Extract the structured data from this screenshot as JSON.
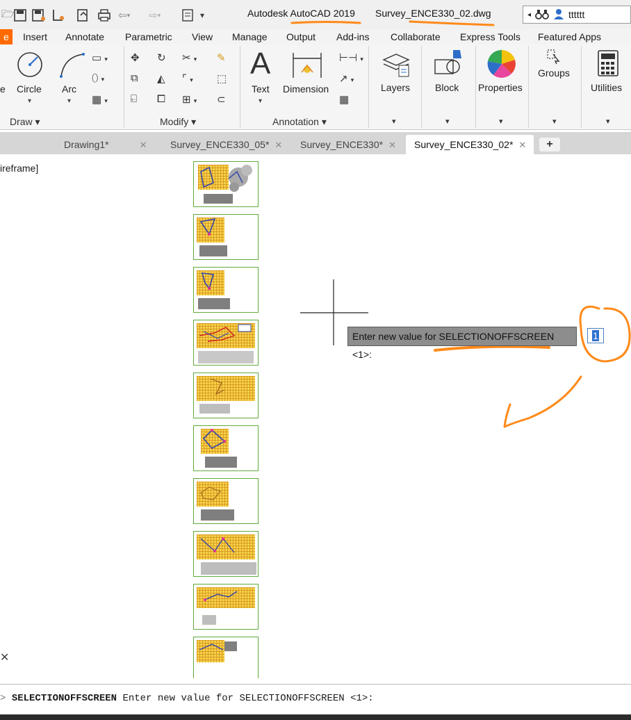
{
  "titlebar": {
    "app_title": "Autodesk AutoCAD 2019",
    "doc_title": "Survey_ENCE330_02.dwg",
    "user": "tttttt",
    "quick_access_icons": [
      "open-icon",
      "save-icon",
      "save-as-icon",
      "plot-preview-icon",
      "publish-icon",
      "print-icon",
      "undo-icon",
      "redo-icon",
      "workspace-icon",
      "customize-icon"
    ],
    "search_icons": [
      "back-arrow-icon",
      "binoculars-icon",
      "user-icon"
    ]
  },
  "ribbon_tabs": [
    "e",
    "Insert",
    "Annotate",
    "Parametric",
    "View",
    "Manage",
    "Output",
    "Add-ins",
    "Collaborate",
    "Express Tools",
    "Featured Apps"
  ],
  "ribbon": {
    "draw": {
      "line_partial": "e",
      "circle": "Circle",
      "arc": "Arc",
      "panel": "Draw"
    },
    "modify": {
      "panel": "Modify"
    },
    "annotation": {
      "text": "Text",
      "dimension": "Dimension",
      "panel": "Annotation"
    },
    "layers": "Layers",
    "block": "Block",
    "properties": "Properties",
    "groups": "Groups",
    "utilities": "Utilities"
  },
  "doc_tabs": [
    {
      "label": "Drawing1*",
      "active": false
    },
    {
      "label": "Survey_ENCE330_05*",
      "active": false
    },
    {
      "label": "Survey_ENCE330*",
      "active": false
    },
    {
      "label": "Survey_ENCE330_02*",
      "active": false
    }
  ],
  "active_doc_tab": "Survey_ENCE330_02*",
  "viewport_label": "ireframe]",
  "prompt": {
    "text": "Enter new value for SELECTIONOFFSCREEN <1>:",
    "input_value": "1"
  },
  "command_line": {
    "command": "SELECTIONOFFSCREEN",
    "message": "Enter new value for SELECTIONOFFSCREEN <1>:"
  },
  "colors": {
    "accent": "#ff6a00",
    "annotation": "#ff8a1a",
    "thumb_border": "#5faa3c",
    "grid": "#f6d34b"
  }
}
